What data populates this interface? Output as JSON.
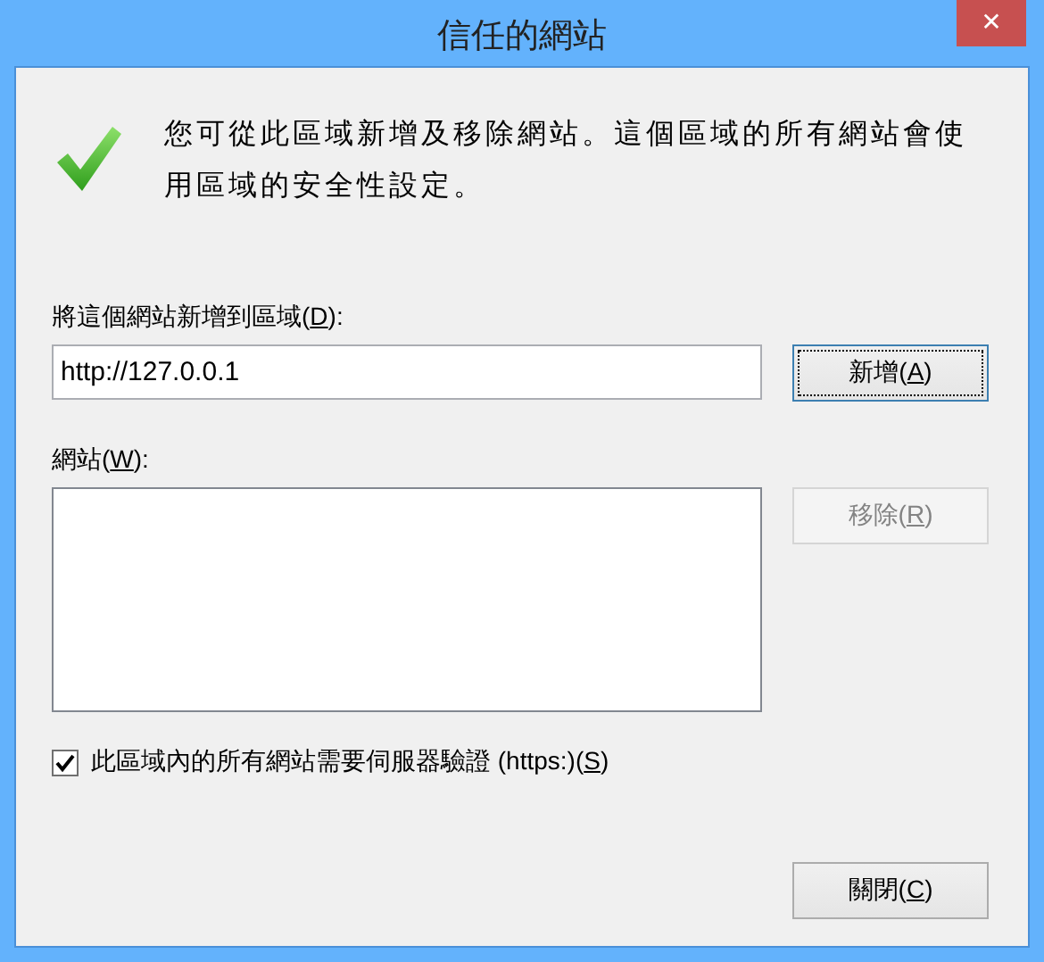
{
  "window": {
    "title": "信任的網站",
    "close": "✕"
  },
  "message": "您可從此區域新增及移除網站。這個區域的所有網站會使用區域的安全性設定。",
  "add_field": {
    "label": {
      "before": "將這個網站新增到區域(",
      "key": "D",
      "after": "):"
    },
    "value": "http://127.0.0.1"
  },
  "add_button": {
    "label": {
      "before": "新增(",
      "key": "A",
      "after": ")"
    },
    "disabled": false,
    "focused": true
  },
  "sites_list": {
    "label": {
      "before": "網站(",
      "key": "W",
      "after": "):"
    }
  },
  "remove_button": {
    "label": {
      "before": "移除(",
      "key": "R",
      "after": ")"
    },
    "disabled": true,
    "focused": false
  },
  "https_checkbox": {
    "label": {
      "before": "此區域內的所有網站需要伺服器驗證 (https:)(",
      "key": "S",
      "after": ")"
    },
    "checked": true
  },
  "close_button": {
    "label": {
      "before": "關閉(",
      "key": "C",
      "after": ")"
    },
    "disabled": false,
    "focused": false
  }
}
